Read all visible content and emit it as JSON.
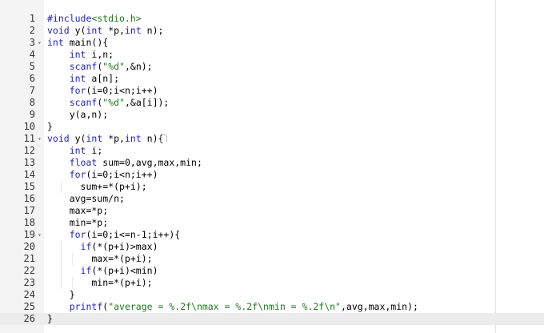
{
  "editor": {
    "lines": [
      {
        "number": "1",
        "fold": "",
        "indent": 0,
        "tokens": [
          {
            "t": "#include",
            "c": "pp"
          },
          {
            "t": "<stdio.h>",
            "c": "str"
          }
        ]
      },
      {
        "number": "2",
        "fold": "",
        "indent": 0,
        "tokens": [
          {
            "t": "void",
            "c": "kw"
          },
          {
            "t": " y(",
            "c": ""
          },
          {
            "t": "int",
            "c": "kw"
          },
          {
            "t": " *p,",
            "c": ""
          },
          {
            "t": "int",
            "c": "kw"
          },
          {
            "t": " n);",
            "c": ""
          }
        ]
      },
      {
        "number": "3",
        "fold": "▾",
        "indent": 0,
        "tokens": [
          {
            "t": "int",
            "c": "kw"
          },
          {
            "t": " main(){",
            "c": ""
          }
        ]
      },
      {
        "number": "4",
        "fold": "",
        "indent": 1,
        "tokens": [
          {
            "t": "    ",
            "c": ""
          },
          {
            "t": "int",
            "c": "kw"
          },
          {
            "t": " i,n;",
            "c": ""
          }
        ]
      },
      {
        "number": "5",
        "fold": "",
        "indent": 1,
        "tokens": [
          {
            "t": "    ",
            "c": ""
          },
          {
            "t": "scanf",
            "c": "kw"
          },
          {
            "t": "(",
            "c": ""
          },
          {
            "t": "\"%d\"",
            "c": "str"
          },
          {
            "t": ",&n);",
            "c": ""
          }
        ]
      },
      {
        "number": "6",
        "fold": "",
        "indent": 1,
        "tokens": [
          {
            "t": "    ",
            "c": ""
          },
          {
            "t": "int",
            "c": "kw"
          },
          {
            "t": " a[n];",
            "c": ""
          }
        ]
      },
      {
        "number": "7",
        "fold": "",
        "indent": 1,
        "tokens": [
          {
            "t": "    ",
            "c": ""
          },
          {
            "t": "for",
            "c": "kw"
          },
          {
            "t": "(i=0;i<n;i++)",
            "c": ""
          }
        ]
      },
      {
        "number": "8",
        "fold": "",
        "indent": 1,
        "tokens": [
          {
            "t": "    ",
            "c": ""
          },
          {
            "t": "scanf",
            "c": "kw"
          },
          {
            "t": "(",
            "c": ""
          },
          {
            "t": "\"%d\"",
            "c": "str"
          },
          {
            "t": ",&a[i]);",
            "c": ""
          }
        ]
      },
      {
        "number": "9",
        "fold": "",
        "indent": 1,
        "tokens": [
          {
            "t": "    y(a,n);",
            "c": ""
          }
        ]
      },
      {
        "number": "10",
        "fold": "",
        "indent": 0,
        "tokens": [
          {
            "t": "}",
            "c": ""
          }
        ]
      },
      {
        "number": "11",
        "fold": "▾",
        "indent": 0,
        "tokens": [
          {
            "t": "void",
            "c": "kw"
          },
          {
            "t": " y(",
            "c": ""
          },
          {
            "t": "int",
            "c": "kw"
          },
          {
            "t": " *p,",
            "c": ""
          },
          {
            "t": "int",
            "c": "kw"
          },
          {
            "t": " n){",
            "c": ""
          }
        ]
      },
      {
        "number": "12",
        "fold": "",
        "indent": 1,
        "tokens": [
          {
            "t": "    ",
            "c": ""
          },
          {
            "t": "int",
            "c": "kw"
          },
          {
            "t": " i;",
            "c": ""
          }
        ]
      },
      {
        "number": "13",
        "fold": "",
        "indent": 1,
        "tokens": [
          {
            "t": "    ",
            "c": ""
          },
          {
            "t": "float",
            "c": "kw"
          },
          {
            "t": " sum=0,avg,max,min;",
            "c": ""
          }
        ]
      },
      {
        "number": "14",
        "fold": "",
        "indent": 1,
        "tokens": [
          {
            "t": "    ",
            "c": ""
          },
          {
            "t": "for",
            "c": "kw"
          },
          {
            "t": "(i=0;i<n;i++)",
            "c": ""
          }
        ]
      },
      {
        "number": "15",
        "fold": "",
        "indent": 2,
        "tokens": [
          {
            "t": "      sum+=*(p+i);",
            "c": ""
          }
        ]
      },
      {
        "number": "16",
        "fold": "",
        "indent": 1,
        "tokens": [
          {
            "t": "    avg=sum/n;",
            "c": ""
          }
        ]
      },
      {
        "number": "17",
        "fold": "",
        "indent": 1,
        "tokens": [
          {
            "t": "    max=*p;",
            "c": ""
          }
        ]
      },
      {
        "number": "18",
        "fold": "",
        "indent": 1,
        "tokens": [
          {
            "t": "    min=*p;",
            "c": ""
          }
        ]
      },
      {
        "number": "19",
        "fold": "▾",
        "indent": 1,
        "tokens": [
          {
            "t": "    ",
            "c": ""
          },
          {
            "t": "for",
            "c": "kw"
          },
          {
            "t": "(i=0;i<=n-1;i++){",
            "c": ""
          }
        ]
      },
      {
        "number": "20",
        "fold": "",
        "indent": 2,
        "tokens": [
          {
            "t": "      ",
            "c": ""
          },
          {
            "t": "if",
            "c": "kw"
          },
          {
            "t": "(*(p+i)>max)",
            "c": ""
          }
        ]
      },
      {
        "number": "21",
        "fold": "",
        "indent": 3,
        "tokens": [
          {
            "t": "        max=*(p+i);",
            "c": ""
          }
        ]
      },
      {
        "number": "22",
        "fold": "",
        "indent": 2,
        "tokens": [
          {
            "t": "      ",
            "c": ""
          },
          {
            "t": "if",
            "c": "kw"
          },
          {
            "t": "(*(p+i)<min)",
            "c": ""
          }
        ]
      },
      {
        "number": "23",
        "fold": "",
        "indent": 3,
        "tokens": [
          {
            "t": "        min=*(p+i);",
            "c": ""
          }
        ]
      },
      {
        "number": "24",
        "fold": "",
        "indent": 1,
        "tokens": [
          {
            "t": "    }",
            "c": ""
          }
        ]
      },
      {
        "number": "25",
        "fold": "",
        "indent": 1,
        "tokens": [
          {
            "t": "    ",
            "c": ""
          },
          {
            "t": "printf",
            "c": "kw"
          },
          {
            "t": "(",
            "c": ""
          },
          {
            "t": "\"average = %.2f\\nmax = %.2f\\nmin = %.2f\\n\"",
            "c": "str"
          },
          {
            "t": ",avg,max,min);",
            "c": ""
          }
        ]
      },
      {
        "number": "26",
        "fold": "",
        "indent": 0,
        "active": true,
        "tokens": [
          {
            "t": "}",
            "c": ""
          }
        ]
      }
    ]
  },
  "colors": {
    "keyword": "#2020c8",
    "string": "#1a7c1a",
    "gutter_bg": "#f4f4f4",
    "active_line": "#ececec"
  }
}
